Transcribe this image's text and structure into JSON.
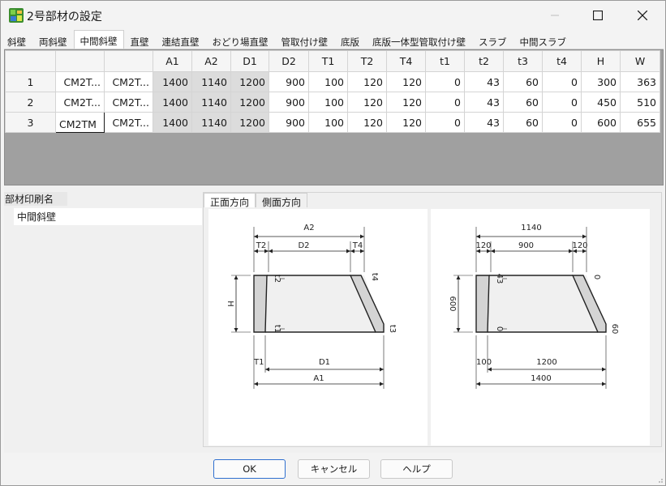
{
  "window": {
    "title": "2号部材の設定"
  },
  "tabs": [
    "斜壁",
    "両斜壁",
    "中間斜壁",
    "直壁",
    "連結直壁",
    "おどり場直壁",
    "管取付け壁",
    "底版",
    "底版一体型管取付け壁",
    "スラブ",
    "中間スラブ"
  ],
  "active_tab_index": 2,
  "grid": {
    "headers": [
      "",
      "",
      "",
      "A1",
      "A2",
      "D1",
      "D2",
      "T1",
      "T2",
      "T4",
      "t1",
      "t2",
      "t3",
      "t4",
      "H",
      "W"
    ],
    "rows": [
      [
        "1",
        "CM2T...",
        "CM2T...",
        "1400",
        "1140",
        "1200",
        "900",
        "100",
        "120",
        "120",
        "0",
        "43",
        "60",
        "0",
        "300",
        "363"
      ],
      [
        "2",
        "CM2T...",
        "CM2T...",
        "1400",
        "1140",
        "1200",
        "900",
        "100",
        "120",
        "120",
        "0",
        "43",
        "60",
        "0",
        "450",
        "510"
      ],
      [
        "3",
        "CM2TM",
        "CM2T...",
        "1400",
        "1140",
        "1200",
        "900",
        "100",
        "120",
        "120",
        "0",
        "43",
        "60",
        "0",
        "600",
        "655"
      ]
    ]
  },
  "print_name": {
    "label": "部材印刷名",
    "value": "中間斜壁"
  },
  "direction_tabs": [
    "正面方向",
    "側面方向"
  ],
  "diagram_left": {
    "labels": {
      "A2": "A2",
      "T2": "T2",
      "D2": "D2",
      "T4": "T4",
      "H": "H",
      "t2": "t2",
      "t4": "t4",
      "t1": "t1",
      "t3": "t3",
      "T1": "T1",
      "D1": "D1",
      "A1": "A1"
    }
  },
  "diagram_right": {
    "labels": {
      "A2": "1140",
      "T2": "120",
      "D2": "900",
      "T4": "120",
      "H": "600",
      "t2": "43",
      "t4": "0",
      "t1": "0",
      "t3": "60",
      "T1": "100",
      "D1": "1200",
      "A1": "1400"
    }
  },
  "buttons": {
    "ok": "OK",
    "cancel": "キャンセル",
    "help": "ヘルプ"
  }
}
